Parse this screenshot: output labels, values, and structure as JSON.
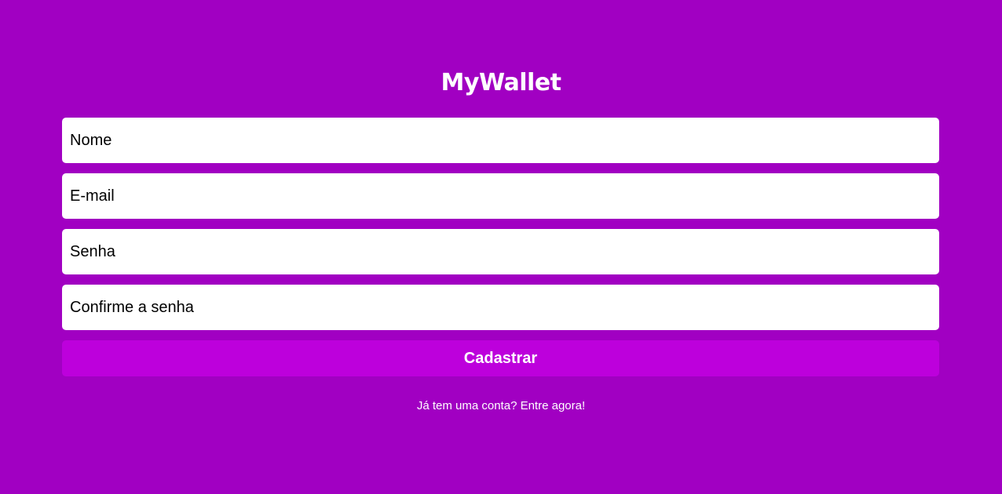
{
  "app": {
    "logo": "MyWallet"
  },
  "form": {
    "name_placeholder": "Nome",
    "email_placeholder": "E-mail",
    "password_placeholder": "Senha",
    "confirm_password_placeholder": "Confirme a senha",
    "submit_label": "Cadastrar"
  },
  "footer": {
    "login_link": "Já tem uma conta? Entre agora!"
  },
  "colors": {
    "background": "#a100c2",
    "button": "#bd00dc",
    "input_background": "#ffffff",
    "text_light": "#ffffff"
  }
}
